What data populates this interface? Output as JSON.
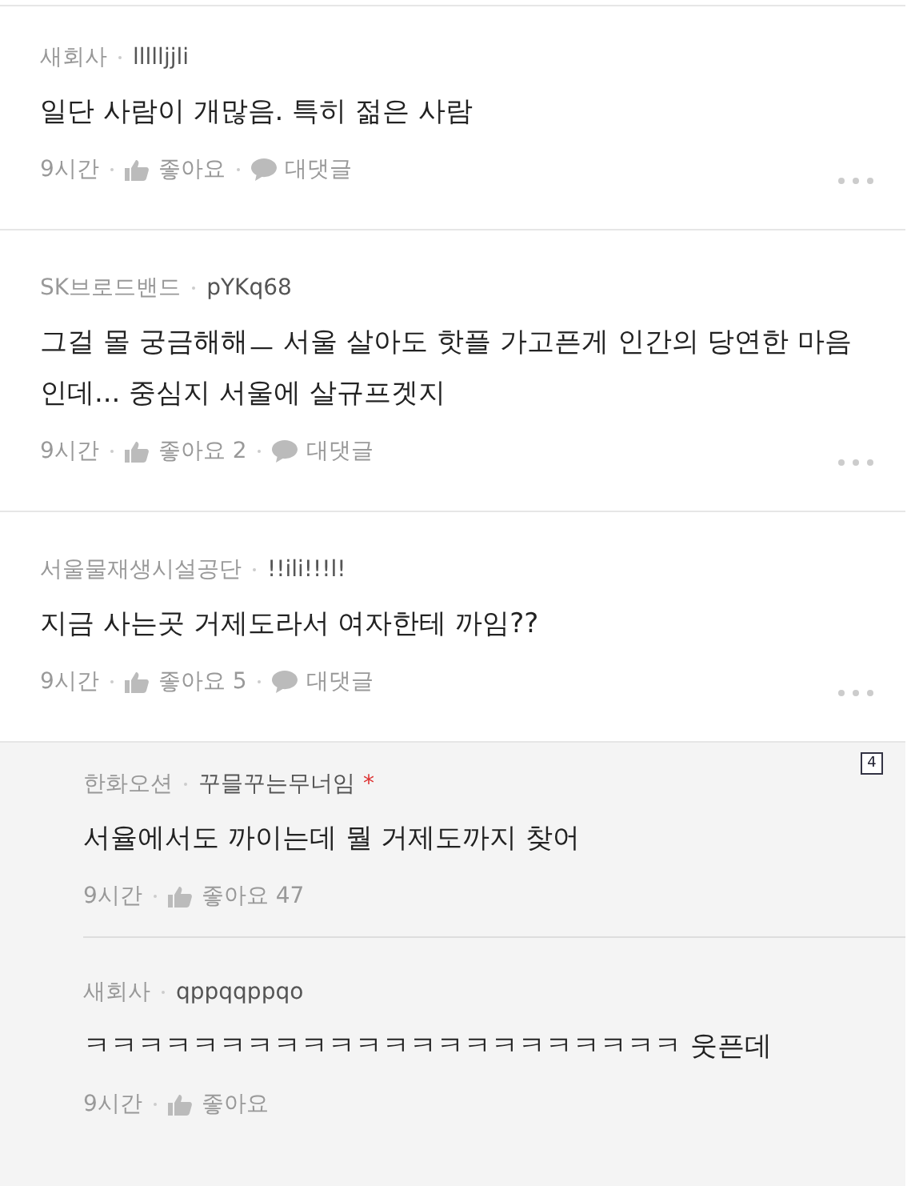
{
  "comments": [
    {
      "kind": "comment",
      "carrier": "새회사",
      "user": "llllljjli",
      "text": "일단 사람이 개많음. 특히 젊은 사람",
      "time": "9시간",
      "likes": "좋아요",
      "reply": "대댓글"
    },
    {
      "kind": "comment",
      "carrier": "SK브로드밴드",
      "user": "pYKq68",
      "text": "그걸 몰 궁금해해ㅡ 서울 살아도 핫플 가고픈게 인간의 당연한 마음인데... 중심지 서울에 살규프겟지",
      "time": "9시간",
      "likes": "좋아요 2",
      "reply": "대댓글"
    },
    {
      "kind": "comment",
      "carrier": "서울물재생시설공단",
      "user": "!!ili!!!l!",
      "text": "지금 사는곳 거제도라서 여자한테 까임??",
      "time": "9시간",
      "likes": "좋아요 5",
      "reply": "대댓글"
    }
  ],
  "replies": {
    "count_badge": "4",
    "items": [
      {
        "carrier": "한화오션",
        "user": "꾸믈꾸는무너임",
        "best_mark": "*",
        "text": "서율에서도 까이는데 뭘 거제도까지 찾어",
        "time": "9시간",
        "likes": "좋아요 47"
      },
      {
        "carrier": "새회사",
        "user": "qppqqppqo",
        "text": "ㅋㅋㅋㅋㅋㅋㅋㅋㅋㅋㅋㅋㅋㅋㅋㅋㅋㅋㅋㅋㅋㅋ 웃픈데",
        "time": "9시간",
        "likes": "좋아요"
      }
    ]
  }
}
